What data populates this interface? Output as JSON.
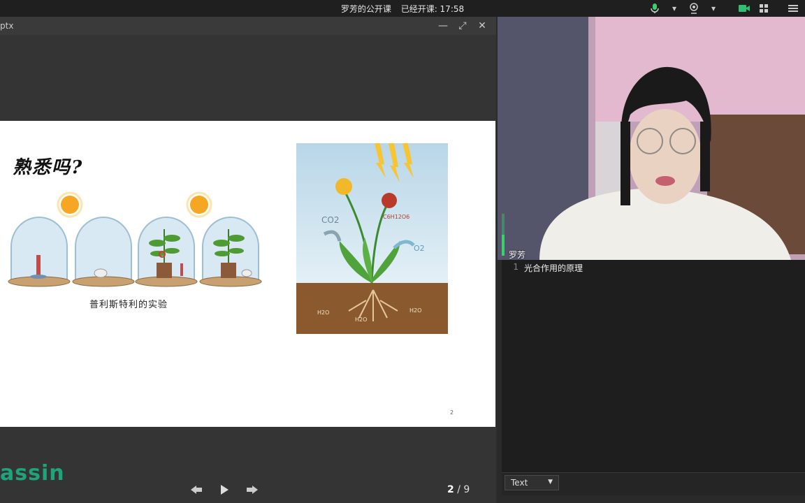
{
  "topbar": {
    "course_title": "罗芳的公开课",
    "status": "已经开课: 17:58"
  },
  "icons": {
    "mic": "microphone-icon",
    "camera": "webcam-icon",
    "video": "video-camera-icon",
    "grid": "grid-icon",
    "menu": "hamburger-menu-icon"
  },
  "viewer": {
    "filename": "ptx",
    "slide": {
      "title": "熟悉吗?",
      "caption": "普利斯特利的实验",
      "page_number": "2"
    },
    "logo": "assin",
    "pager": {
      "current": "2",
      "separator": " / ",
      "total": "9"
    }
  },
  "plant_labels": {
    "co2": "CO2",
    "glucose": "C6H12O6",
    "o2": "O2",
    "h2o": "H2O"
  },
  "video": {
    "username": "罗芳"
  },
  "editor": {
    "lines": [
      {
        "no": "1",
        "text": "光合作用的原理"
      }
    ],
    "language": "Text"
  },
  "colors": {
    "accent_green": "#1fa37a",
    "mic_green": "#3ecf6a",
    "video_green": "#2fbf71"
  }
}
